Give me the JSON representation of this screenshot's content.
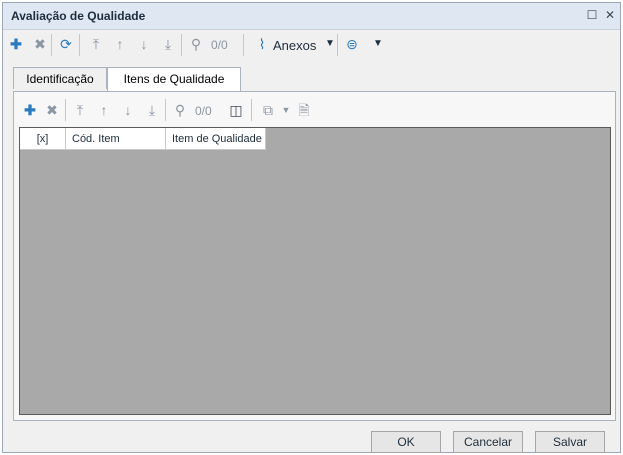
{
  "window": {
    "title": "Avaliação de Qualidade"
  },
  "titlebar_buttons": [
    {
      "glyph": "☐"
    },
    {
      "glyph": "✕"
    }
  ],
  "toolbar": {
    "counter": "0/0",
    "anexos_label": "Anexos"
  },
  "tabs": [
    {
      "label": "Identificação"
    },
    {
      "label": "Itens de Qualidade"
    }
  ],
  "subtoolbar": {
    "counter": "0/0"
  },
  "grid": {
    "columns": [
      "[x]",
      "Cód. Item",
      "Item de Qualidade"
    ]
  },
  "footer": {
    "ok_label": "OK",
    "cancel_label": "Cancelar",
    "save_label": "Salvar"
  },
  "colors": {
    "titlebar": "#dfe8f2",
    "grid_bg": "#a9a9a9",
    "accent": "#2b7bbf"
  }
}
